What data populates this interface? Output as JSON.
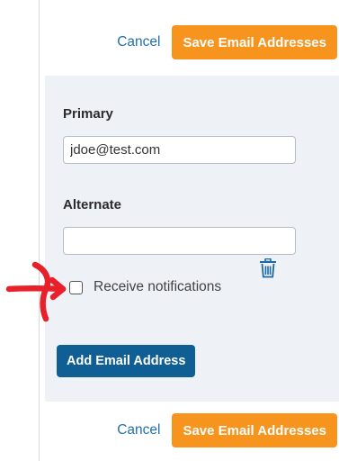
{
  "top_actions": {
    "cancel_label": "Cancel",
    "save_label": "Save Email Addresses"
  },
  "form": {
    "primary": {
      "label": "Primary",
      "value": "jdoe@test.com"
    },
    "alternate": {
      "label": "Alternate",
      "value": ""
    },
    "notifications": {
      "label": "Receive notifications",
      "checked": false
    },
    "add_label": "Add Email Address",
    "delete_icon": "trash-icon"
  },
  "bottom_actions": {
    "cancel_label": "Cancel",
    "save_label": "Save Email Addresses"
  },
  "annotation": {
    "arrow_icon": "red-arrow-annotation",
    "arrow_color": "#e8202a"
  },
  "colors": {
    "save_button": "#f7941d",
    "add_button": "#0f5f95",
    "link": "#1f6fb0",
    "panel_background": "#eef2f7"
  }
}
